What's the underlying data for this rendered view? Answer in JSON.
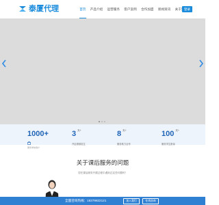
{
  "header": {
    "logo_text": "泰厦代理",
    "nav": [
      {
        "label": "首页",
        "active": true
      },
      {
        "label": "产品介绍",
        "active": false
      },
      {
        "label": "运营服务",
        "active": false
      },
      {
        "label": "客户案例",
        "active": false
      },
      {
        "label": "合作加盟",
        "active": false
      },
      {
        "label": "新闻资讯",
        "active": false
      },
      {
        "label": "关于我们",
        "active": false
      }
    ],
    "login_label": "登录"
  },
  "colors": {
    "brand": "#1b8cdb",
    "stat_number": "#1d63b8",
    "contact_band": "#2f7fd3",
    "banner_bg": "#dcdcdc"
  },
  "stats": [
    {
      "value": "1000+",
      "unit": "",
      "label": "",
      "sub": "服务学校用户"
    },
    {
      "value": "3",
      "unit": "天+",
      "label": "开启视频招生",
      "sub": ""
    },
    {
      "value": "8",
      "unit": "天+",
      "label": "服务助力合作",
      "sub": ""
    },
    {
      "value": "100",
      "unit": "天+",
      "label": "服务学生数量",
      "sub": ""
    }
  ],
  "about": {
    "title": "关于课后服务的问题",
    "desc": "您在课后服务开展过程中遇到过这些问题吗？"
  },
  "contact": {
    "hotline_label": "全国咨询热线：",
    "phone": "18379822121",
    "join_button": "加入我们",
    "online_button": "在线咨询"
  },
  "icons": [
    "logo-icon",
    "arrow-left-icon",
    "arrow-right-icon",
    "school-icon",
    "person-illustration"
  ]
}
